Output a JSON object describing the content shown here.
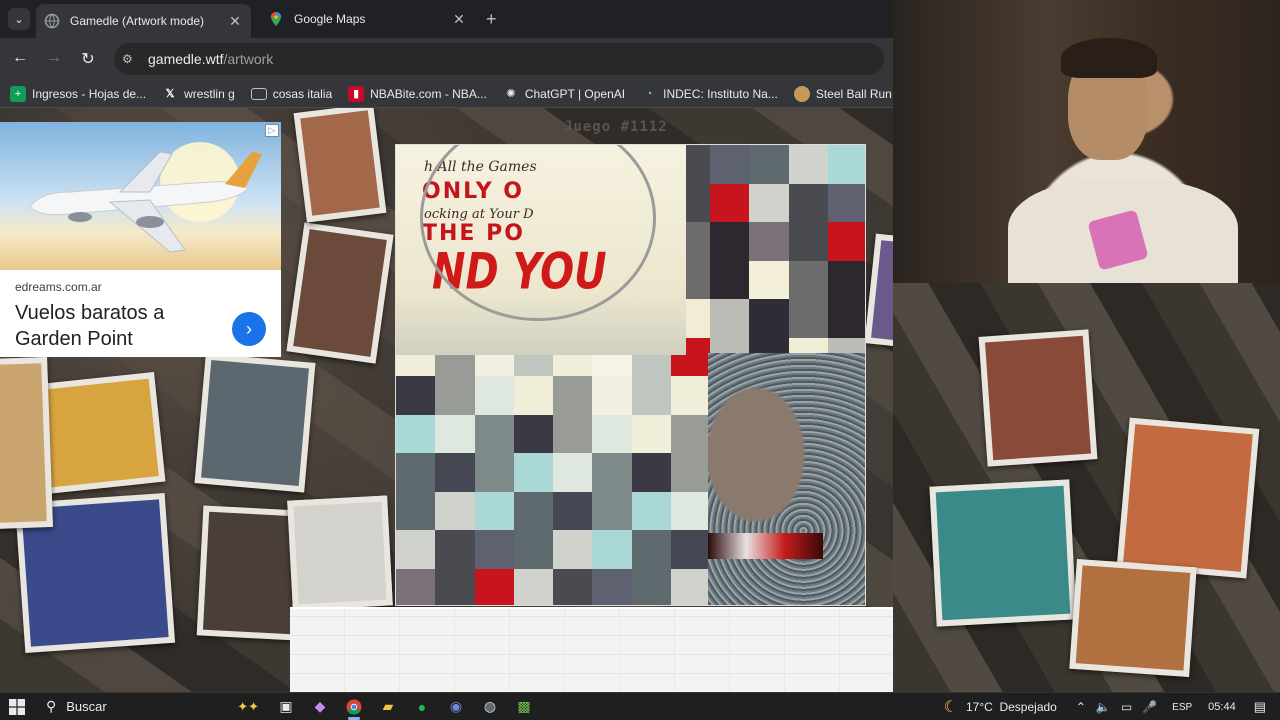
{
  "browser": {
    "tabs": [
      {
        "label": "Gamedle (Artwork mode)",
        "active": true
      },
      {
        "label": "Google Maps",
        "active": false
      }
    ],
    "url_host": "gamedle.wtf",
    "url_path": "/artwork",
    "bookmarks": [
      {
        "label": "Ingresos - Hojas de..."
      },
      {
        "label": "wrestlin g"
      },
      {
        "label": "cosas italia"
      },
      {
        "label": "NBABite.com - NBA..."
      },
      {
        "label": "ChatGPT | OpenAI"
      },
      {
        "label": "INDEC: Instituto Na..."
      },
      {
        "label": "Steel Ball Run Man"
      }
    ]
  },
  "page": {
    "game_label": "Juego #1112",
    "ad": {
      "domain": "edreams.com.ar",
      "headline": "Vuelos baratos a Garden Point"
    },
    "artwork_text": {
      "line1": "h All the Games",
      "line2": "ONLY O",
      "line3": "ocking at Your D",
      "line4": "THE PO",
      "line5": "ND YOU"
    }
  },
  "taskbar": {
    "search_label": "Buscar",
    "temperature": "17°C",
    "weather": "Despejado",
    "lang": "ESP",
    "time": "05:44"
  },
  "colors": {
    "accent": "#1a73e8",
    "browser_dark": "#202124",
    "pixel_palette": [
      "#f3efd9",
      "#f0ecd6",
      "#f6f2e4",
      "#f0edd8",
      "#dfe8df",
      "#aad8d6",
      "#cfd3cc",
      "#6c6c6c",
      "#bbbcb6",
      "#bfc6c0",
      "#999c96",
      "#7e8a8a",
      "#5e6a6e",
      "#4a4b50",
      "#2d2830",
      "#302c36",
      "#c8141c",
      "#f2f0e0",
      "#3b3a44",
      "#454853",
      "#5e6270",
      "#7c7178"
    ]
  }
}
